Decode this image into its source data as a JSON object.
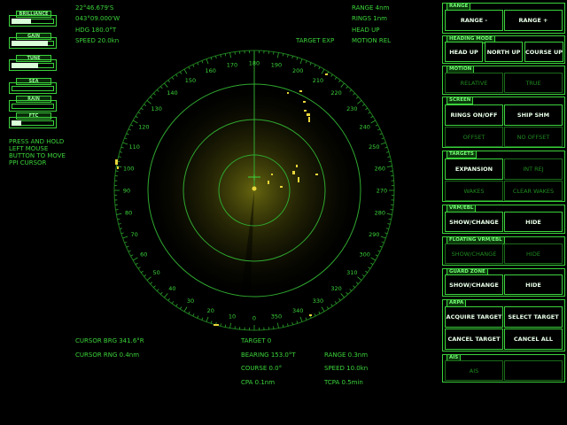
{
  "gauges": [
    {
      "label": "BRILLIANCE",
      "level": 0.45
    },
    {
      "label": "GAIN",
      "level": 0.85
    },
    {
      "label": "TUNE",
      "level": 0.62
    },
    {
      "label": "SEA",
      "level": 0.0
    },
    {
      "label": "RAIN",
      "level": 0.0
    },
    {
      "label": "FTC",
      "level": 0.22
    }
  ],
  "instructions": [
    "PRESS AND HOLD",
    "LEFT MOUSE",
    "BUTTON TO MOVE",
    "PPI CURSOR"
  ],
  "nav": {
    "lat": "22°46.679'S",
    "lon": "043°09.000'W",
    "hdg": "HDG 180.0°T",
    "speed": "SPEED 20.0kn"
  },
  "status": {
    "range": "RANGE 4nm",
    "rings": "RINGS 1nm",
    "head_up": "HEAD UP",
    "motion": "MOTION REL",
    "target_exp": "TARGET EXP"
  },
  "bearing_labels": [
    "180",
    "190",
    "200",
    "210",
    "220",
    "230",
    "240",
    "250",
    "260",
    "270",
    "280",
    "290",
    "300",
    "310",
    "320",
    "330",
    "340",
    "350",
    "0",
    "10",
    "20",
    "30",
    "40",
    "50",
    "60",
    "70",
    "80",
    "90",
    "100",
    "110",
    "120",
    "130",
    "140",
    "150",
    "160",
    "170"
  ],
  "cursor": {
    "brg": "CURSOR BRG 341.6°R",
    "rng": "CURSOR RNG 0.4nm"
  },
  "target": {
    "title": "TARGET 0",
    "bearing": "BEARING 153.0°T",
    "range": "RANGE  0.3nm",
    "course": "COURSE 0.0°",
    "speed": "SPEED  10.0kn",
    "cpa": "CPA   0.1nm",
    "tcpa": "TCPA  0.5min"
  },
  "panels": {
    "range": {
      "title": "RANGE",
      "minus": "RANGE -",
      "plus": "RANGE +"
    },
    "heading": {
      "title": "HEADING MODE",
      "head_up": "HEAD UP",
      "north_up": "NORTH UP",
      "course_up": "COURSE UP"
    },
    "motion": {
      "title": "MOTION",
      "relative": "RELATIVE",
      "true": "TRUE"
    },
    "screen": {
      "title": "SCREEN",
      "rings": "RINGS ON/OFF",
      "ship_shm": "SHIP SHM",
      "offset": "OFFSET",
      "no_offset": "NO OFFSET"
    },
    "targets": {
      "title": "TARGETS",
      "expansion": "EXPANSION",
      "int_rej": "INT REJ",
      "wakes": "WAKES",
      "clear_wakes": "CLEAR WAKES"
    },
    "vrm_ebl": {
      "title": "VRM/EBL",
      "show": "SHOW/CHANGE",
      "hide": "HIDE"
    },
    "floating": {
      "title": "FLOATING VRM/EBL",
      "show": "SHOW/CHANGE",
      "hide": "HIDE"
    },
    "guard": {
      "title": "GUARD ZONE",
      "show": "SHOW/CHANGE",
      "hide": "HIDE"
    },
    "arpa": {
      "title": "ARPA",
      "acquire": "ACQUIRE TARGET",
      "select": "SELECT TARGET",
      "cancel": "CANCEL TARGET",
      "cancel_all": "CANCEL ALL"
    },
    "ais": {
      "title": "AIS",
      "ais": "AIS"
    }
  }
}
